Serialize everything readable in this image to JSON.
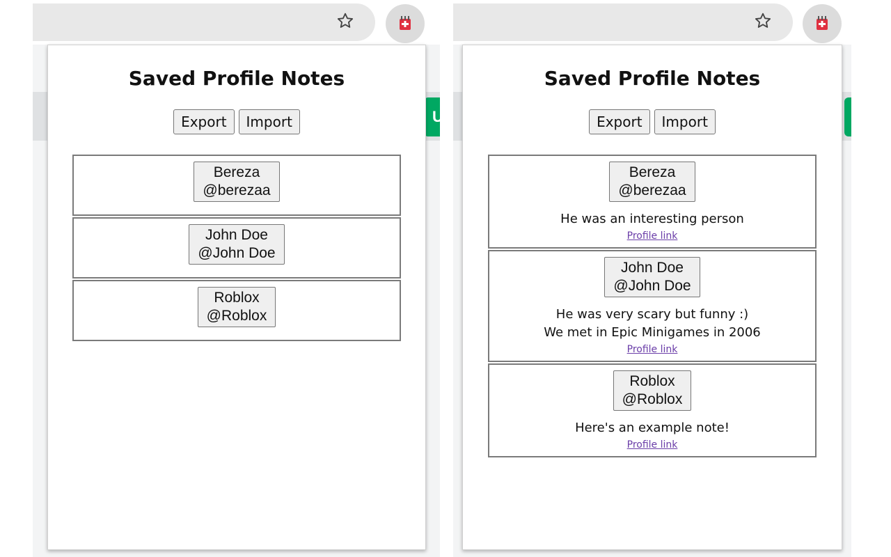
{
  "browser": {
    "star_icon": "star-outline-icon",
    "extension_icon": "notepad-icon",
    "page_badge_text": "U",
    "colors": {
      "accent": "#00a862",
      "link": "#6a3da8",
      "extension": "#e03040"
    }
  },
  "left": {
    "title": "Saved Profile Notes",
    "export_label": "Export",
    "import_label": "Import",
    "entries": [
      {
        "name": "Bereza",
        "handle": "@berezaa"
      },
      {
        "name": "John Doe",
        "handle": "@John Doe"
      },
      {
        "name": "Roblox",
        "handle": "@Roblox"
      }
    ]
  },
  "right": {
    "title": "Saved Profile Notes",
    "export_label": "Export",
    "import_label": "Import",
    "entries": [
      {
        "name": "Bereza",
        "handle": "@berezaa",
        "note_lines": [
          "He was an interesting person"
        ],
        "link_label": "Profile link"
      },
      {
        "name": "John Doe",
        "handle": "@John Doe",
        "note_lines": [
          "He was very scary but funny :)",
          "We met in Epic Minigames in 2006"
        ],
        "link_label": "Profile link"
      },
      {
        "name": "Roblox",
        "handle": "@Roblox",
        "note_lines": [
          "Here's an example note!"
        ],
        "link_label": "Profile link"
      }
    ]
  }
}
